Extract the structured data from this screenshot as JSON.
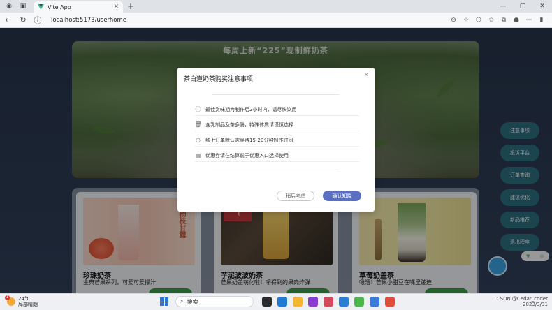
{
  "browser": {
    "tab_title": "Vite App",
    "url": "localhost:5173/userhome"
  },
  "banner": {
    "headline": "每周上新“225”现制鲜奶茶"
  },
  "products": [
    {
      "name": "珍珠奶茶",
      "desc": "金典芒果系列，可爱可爱撑汁",
      "image_label": "杨枝甘露"
    },
    {
      "name": "芋泥波波奶茶",
      "desc": "芒果奶盖萌化啦！嚼得到的果肉炸弹",
      "image_label": "飞"
    },
    {
      "name": "草莓奶盖茶",
      "desc": "吸溜！芒果小甜豆在嘴里蹦迪"
    }
  ],
  "side_menu": [
    "注意事项",
    "投诉平台",
    "订单查询",
    "建议优化",
    "新品推荐",
    "退出程序"
  ],
  "modal": {
    "title": "茶白道奶茶购买注意事项",
    "notices": [
      {
        "icon": "info-icon",
        "text": "最佳赏味期为制作后2小时内，请尽快饮用"
      },
      {
        "icon": "trash-icon",
        "text": "含乳制品及茶多酚，特殊体质请谨慎选择"
      },
      {
        "icon": "clock-icon",
        "text": "线上订单默认需等待15-20分钟制作时间"
      },
      {
        "icon": "coupon-icon",
        "text": "优惠券请在结算前于优惠入口选择使用"
      }
    ],
    "cancel_label": "稍后考虑",
    "ok_label": "确认知晓",
    "accent_color": "#5b6fc2"
  },
  "taskbar": {
    "weather_temp": "24°C",
    "weather_desc": "局部晴朗",
    "weather_badge": "1",
    "search_label": "搜索",
    "date": "2023/3/31",
    "watermark": "CSDN @Cedar_coder"
  }
}
